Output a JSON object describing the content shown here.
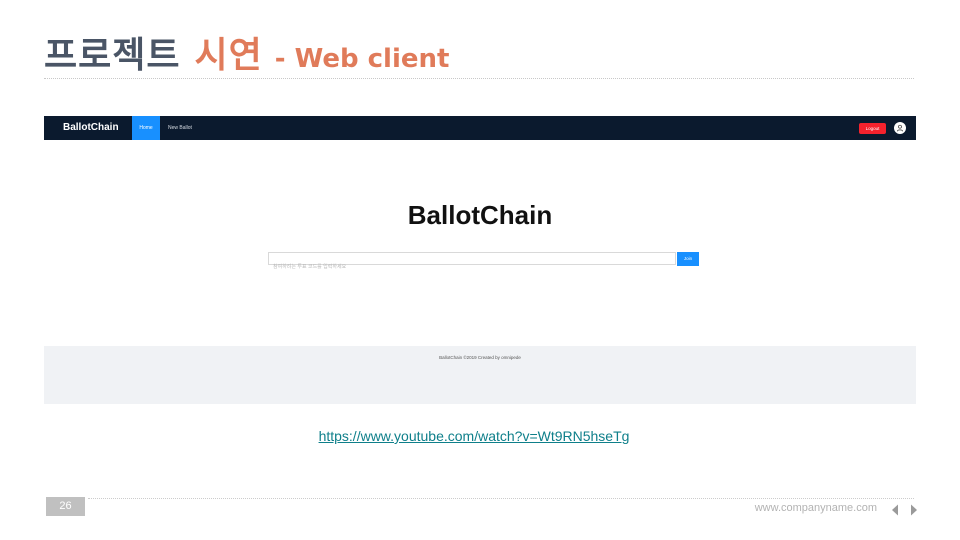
{
  "slide": {
    "title_main": "프로젝트",
    "title_accent": "시연",
    "title_suffix": "- Web client",
    "link_url": "https://www.youtube.com/watch?v=Wt9RN5hseTg",
    "page_number": "26",
    "website": "www.companyname.com"
  },
  "app": {
    "brand": "BallotChain",
    "nav": {
      "home_label": "Home",
      "new_ballot_label": "New Ballot"
    },
    "logout_label": "Logout",
    "hero_title": "BallotChain",
    "search_placeholder": "참여하려는 투표 코드를 입력하세요",
    "join_label": "Join",
    "footer_text": "BallotChain ©2019 Created by omnipede"
  },
  "colors": {
    "navbar": "#0b1a2e",
    "primary": "#1890ff",
    "danger": "#f5222d",
    "accent": "#e07b5a",
    "link": "#0e7f8a"
  },
  "icons": [
    "user-icon",
    "prev-arrow-icon",
    "next-arrow-icon"
  ]
}
